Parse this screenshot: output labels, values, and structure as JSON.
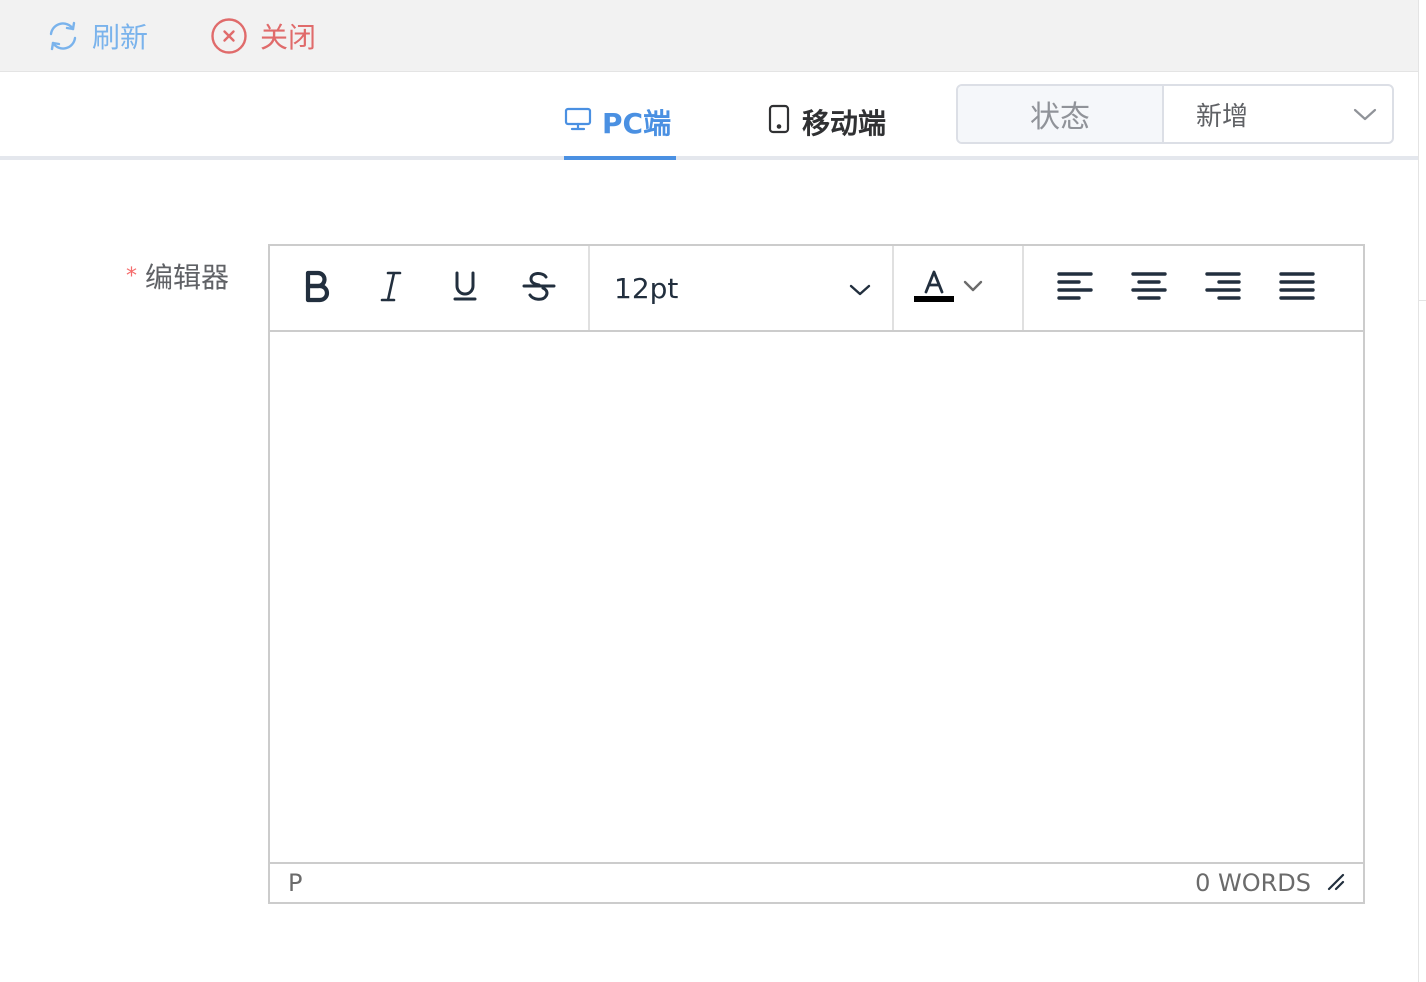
{
  "top_actions": {
    "refresh_label": "刷新",
    "close_label": "关闭",
    "refresh_icon": "refresh-icon",
    "close_icon": "close-circle-icon"
  },
  "tabs": [
    {
      "label": "PC端",
      "icon": "monitor-icon",
      "active": true
    },
    {
      "label": "移动端",
      "icon": "tablet-icon",
      "active": false
    }
  ],
  "status": {
    "label": "状态",
    "selected_value": "新增"
  },
  "form": {
    "required_marker": "*",
    "editor_label": "编辑器"
  },
  "editor": {
    "font_size": "12pt",
    "toolbar_buttons": [
      "bold",
      "italic",
      "underline",
      "strikethrough",
      "font-size",
      "text-color",
      "align-left",
      "align-center",
      "align-right",
      "justify"
    ],
    "content": "",
    "path_indicator": "P",
    "word_count": "0 WORDS"
  },
  "colors": {
    "accent": "#4a90e2",
    "refresh": "#7ab3ec",
    "close": "#e06b6b",
    "required": "#f56c6c",
    "toolbar_icon": "#222f3e"
  }
}
